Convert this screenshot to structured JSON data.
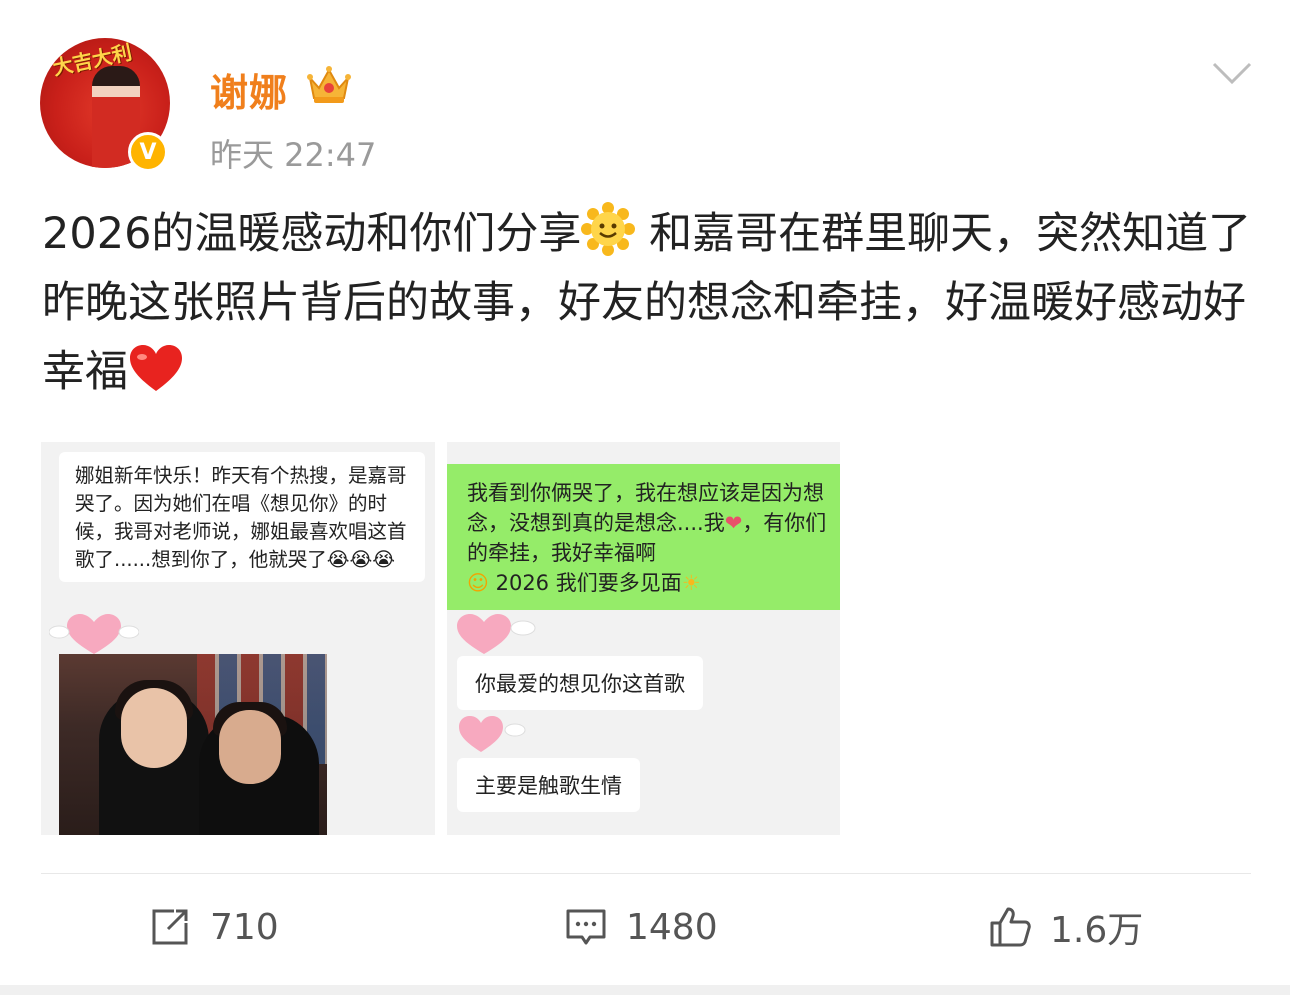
{
  "header": {
    "avatar_logo_text": "大吉大利",
    "username": "谢娜",
    "crown_icon": "crown-icon",
    "verified_icon": "verified-v-icon",
    "timestamp": "昨天 22:47",
    "menu_icon": "chevron-down-icon"
  },
  "post": {
    "text_part1": "2026的温暖感动和你们分享",
    "text_part2": " 和嘉哥在群里聊天，突然知道了昨晚这张照片背后的故事，好友的想念和牵挂，好温暖好感动好幸福",
    "emoji_1": "smiling-sun-emoji",
    "emoji_2": "red-heart-emoji"
  },
  "images": [
    {
      "chat_text": "娜姐新年快乐！昨天有个热搜，是嘉哥哭了。因为她们在唱《想见你》的时候，我哥对老师说，娜姐最喜欢唱这首歌了......想到你了，他就哭了",
      "emoji": "😭😭😭"
    },
    {
      "chat_text_1": "我看到你俩哭了，我在想应该是因为想念，没想到真的是想念....我",
      "chat_text_2": "，有你们的牵挂，我好幸福啊",
      "chat_text_3": "2026 我们要多见面",
      "reply_1": "你最爱的想见你这首歌",
      "reply_2": "主要是触歌生情"
    }
  ],
  "actions": {
    "repost_count": "710",
    "comment_count": "1480",
    "like_count": "1.6万"
  },
  "colors": {
    "username": "#f07f1c",
    "timestamp": "#9a9a9a",
    "chat_green": "#95ec69"
  }
}
